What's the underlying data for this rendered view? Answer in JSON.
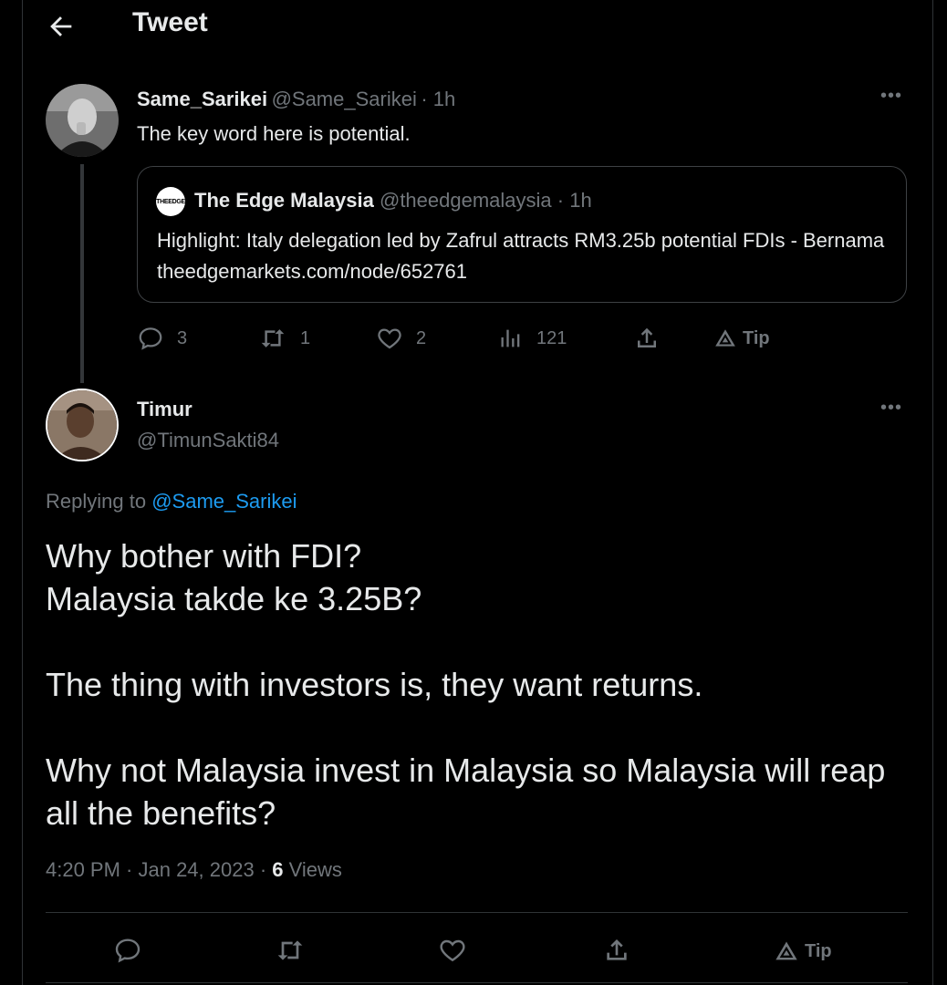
{
  "header": {
    "title": "Tweet"
  },
  "parent_tweet": {
    "display_name": "Same_Sarikei",
    "handle": "@Same_Sarikei",
    "time": "· 1h",
    "text": "The key word here is potential.",
    "quote": {
      "logo_text": "THEEDGE",
      "display_name": "The Edge Malaysia",
      "handle": "@theedgemalaysia",
      "time": "· 1h",
      "text": "Highlight: Italy delegation led by Zafrul attracts RM3.25b potential FDIs - Bernama theedgemarkets.com/node/652761"
    },
    "actions": {
      "replies": "3",
      "retweets": "1",
      "likes": "2",
      "views": "121",
      "tip_label": "Tip"
    }
  },
  "main_tweet": {
    "display_name": "Timur",
    "handle": "@TimunSakti84",
    "replying_prefix": "Replying to",
    "replying_to": "@Same_Sarikei",
    "lines": [
      "Why bother with FDI?",
      "Malaysia takde ke 3.25B?",
      "The thing with investors is, they want returns.",
      "Why not Malaysia invest in Malaysia so Malaysia will reap all the benefits?"
    ],
    "timestamp": "4:20 PM · Jan 24, 2023 · ",
    "views_count": "6",
    "views_label": "Views",
    "tip_label": "Tip"
  },
  "colors": {
    "link": "#1d9bf0",
    "muted": "#71767b",
    "background": "#000000"
  }
}
